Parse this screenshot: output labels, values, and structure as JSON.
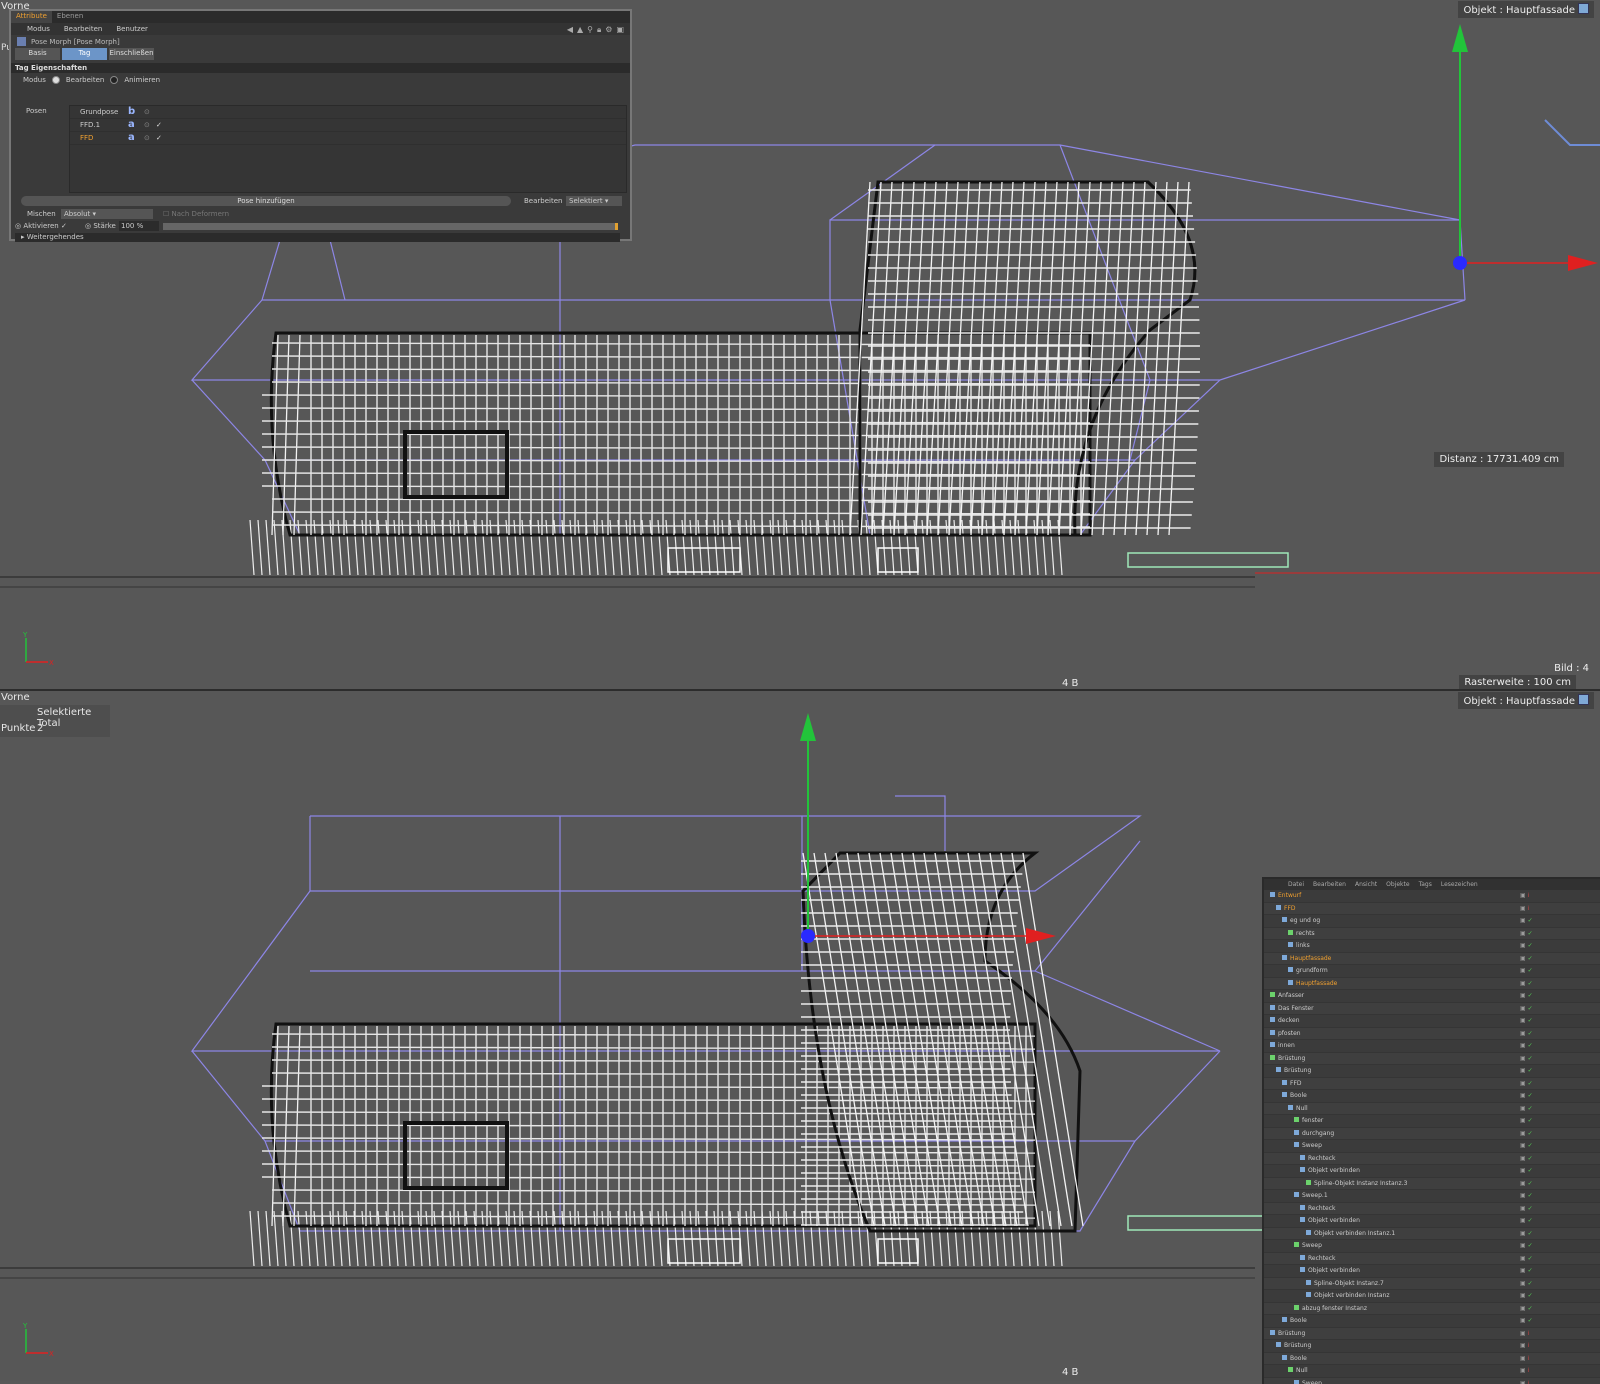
{
  "top_viewport": {
    "label": "Vorne",
    "object_hud": "Objekt : Hauptfassade",
    "distance": "Distanz : 17731.409 cm",
    "frame": "Bild : 4",
    "grid_spacing": "Rasterweite : 100 cm",
    "status_center": "4 B",
    "hidden_label": "Pu"
  },
  "bottom_viewport": {
    "label": "Vorne",
    "object_hud": "Objekt : Hauptfassade",
    "status_center": "4 B",
    "selection_info": {
      "header": "Selektierte Total",
      "key": "Punkte",
      "value": "2"
    }
  },
  "attribute_manager": {
    "tabs": [
      "Attribute",
      "Ebenen"
    ],
    "menu": [
      "Modus",
      "Bearbeiten",
      "Benutzer"
    ],
    "object_title": "Pose Morph [Pose Morph]",
    "buttons": [
      "Basis",
      "Tag",
      "Einschließen"
    ],
    "active_button": "Tag",
    "section": "Tag Eigenschaften",
    "modus_label": "Modus",
    "modus_options": [
      "Bearbeiten",
      "Animieren"
    ],
    "posen_label": "Posen",
    "poses": [
      {
        "name": "Grundpose",
        "letter": "b",
        "selected": false,
        "checked": false
      },
      {
        "name": "FFD.1",
        "letter": "a",
        "selected": false,
        "checked": true
      },
      {
        "name": "FFD",
        "letter": "a",
        "selected": true,
        "checked": true
      }
    ],
    "add_pose": "Pose hinzufügen",
    "edit_label": "Bearbeiten",
    "edit_value": "Selektiert",
    "mix_label": "Mischen",
    "mix_value": "Absolut",
    "after_deformers": "Nach Deformern",
    "activate_label": "Aktivieren",
    "strength_label": "Stärke",
    "strength_value": "100 %",
    "strength_fraction": 1.0,
    "advanced": "Weitergehendes"
  },
  "object_manager": {
    "menu": [
      "Datei",
      "Bearbeiten",
      "Ansicht",
      "Objekte",
      "Tags",
      "Lesezeichen"
    ],
    "items": [
      {
        "name": "Entwurf",
        "depth": 0,
        "color": "orange"
      },
      {
        "name": "FFD",
        "depth": 1,
        "color": "orange"
      },
      {
        "name": "eg und og",
        "depth": 2,
        "color": "normal"
      },
      {
        "name": "rechts",
        "depth": 3,
        "color": "normal"
      },
      {
        "name": "links",
        "depth": 3,
        "color": "normal"
      },
      {
        "name": "Hauptfassade",
        "depth": 2,
        "color": "orange"
      },
      {
        "name": "grundform",
        "depth": 3,
        "color": "normal"
      },
      {
        "name": "Hauptfassade",
        "depth": 3,
        "color": "orange"
      },
      {
        "name": "Anfasser",
        "depth": 0,
        "color": "normal"
      },
      {
        "name": "Das Fenster",
        "depth": 0,
        "color": "normal"
      },
      {
        "name": "decken",
        "depth": 0,
        "color": "normal"
      },
      {
        "name": "pfosten",
        "depth": 0,
        "color": "normal"
      },
      {
        "name": "innen",
        "depth": 0,
        "color": "normal"
      },
      {
        "name": "Brüstung",
        "depth": 0,
        "color": "normal"
      },
      {
        "name": "Brüstung",
        "depth": 1,
        "color": "normal"
      },
      {
        "name": "FFD",
        "depth": 2,
        "color": "normal"
      },
      {
        "name": "Boole",
        "depth": 2,
        "color": "normal"
      },
      {
        "name": "Null",
        "depth": 3,
        "color": "normal"
      },
      {
        "name": "fenster",
        "depth": 4,
        "color": "normal"
      },
      {
        "name": "durchgang",
        "depth": 4,
        "color": "normal"
      },
      {
        "name": "Sweep",
        "depth": 4,
        "color": "normal"
      },
      {
        "name": "Rechteck",
        "depth": 5,
        "color": "normal"
      },
      {
        "name": "Objekt verbinden",
        "depth": 5,
        "color": "normal"
      },
      {
        "name": "Spline-Objekt Instanz Instanz.3",
        "depth": 6,
        "color": "normal"
      },
      {
        "name": "Sweep.1",
        "depth": 4,
        "color": "normal"
      },
      {
        "name": "Rechteck",
        "depth": 5,
        "color": "normal"
      },
      {
        "name": "Objekt verbinden",
        "depth": 5,
        "color": "normal"
      },
      {
        "name": "Objekt verbinden Instanz.1",
        "depth": 6,
        "color": "normal"
      },
      {
        "name": "Sweep",
        "depth": 4,
        "color": "normal"
      },
      {
        "name": "Rechteck",
        "depth": 5,
        "color": "normal"
      },
      {
        "name": "Objekt verbinden",
        "depth": 5,
        "color": "normal"
      },
      {
        "name": "Spline-Objekt Instanz.7",
        "depth": 6,
        "color": "normal"
      },
      {
        "name": "Objekt verbinden Instanz",
        "depth": 6,
        "color": "normal"
      },
      {
        "name": "abzug fenster Instanz",
        "depth": 4,
        "color": "normal"
      },
      {
        "name": "Boole",
        "depth": 2,
        "color": "normal"
      },
      {
        "name": "Brüstung",
        "depth": 0,
        "color": "normal"
      },
      {
        "name": "Brüstung",
        "depth": 1,
        "color": "normal"
      },
      {
        "name": "Boole",
        "depth": 2,
        "color": "normal"
      },
      {
        "name": "Null",
        "depth": 3,
        "color": "normal"
      },
      {
        "name": "Sweep",
        "depth": 4,
        "color": "normal"
      },
      {
        "name": "Sweep.1",
        "depth": 4,
        "color": "normal"
      },
      {
        "name": "Sweep",
        "depth": 4,
        "color": "normal"
      }
    ]
  },
  "colors": {
    "viewport_bg": "#575757",
    "cage": "#8d86e6",
    "axis_y": "#22c43a",
    "axis_x": "#e02020",
    "handle": "#2a2aff",
    "accent": "#f0a030",
    "active_button": "#6c95c8"
  },
  "icons": [
    "move-x-arrow-icon",
    "move-y-arrow-icon",
    "axis-gizmo-icon",
    "cube-icon",
    "lock-icon",
    "checkmark-icon"
  ]
}
